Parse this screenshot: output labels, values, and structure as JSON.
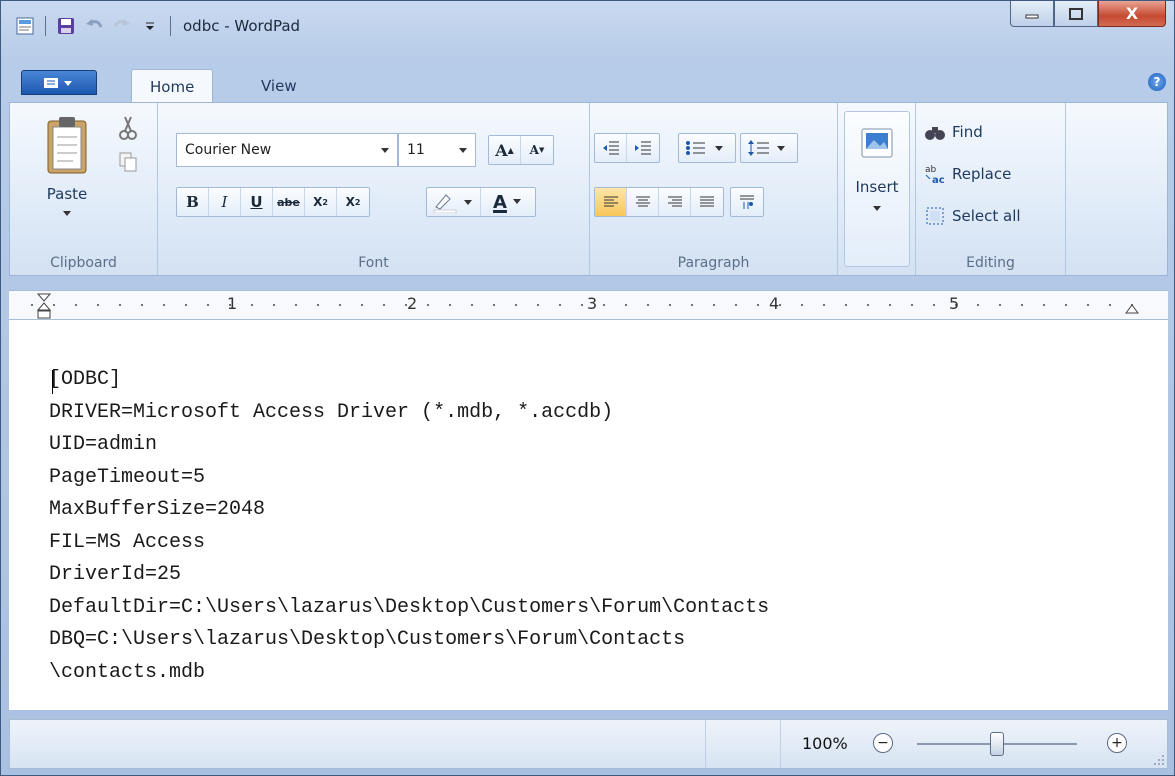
{
  "window": {
    "title": "odbc - WordPad",
    "buttons": {
      "minimize": "minimize",
      "maximize": "maximize",
      "close": "X"
    }
  },
  "tabs": [
    {
      "label": "Home"
    },
    {
      "label": "View"
    }
  ],
  "clipboard": {
    "paste_label": "Paste",
    "group_label": "Clipboard"
  },
  "font": {
    "family": "Courier New",
    "size": "11",
    "grow": "A",
    "shrink": "A",
    "bold": "B",
    "italic": "I",
    "underline": "U",
    "strike": "abe",
    "subscript": "X",
    "superscript": "X",
    "color_glyph": "A",
    "group_label": "Font"
  },
  "paragraph": {
    "group_label": "Paragraph"
  },
  "insert": {
    "label": "Insert"
  },
  "editing": {
    "find": "Find",
    "replace": "Replace",
    "select_all": "Select all",
    "group_label": "Editing"
  },
  "ruler": {
    "marks": [
      "1",
      "2",
      "3",
      "4",
      "5"
    ]
  },
  "document": {
    "lines": [
      "[ODBC]",
      "DRIVER=Microsoft Access Driver (*.mdb, *.accdb)",
      "UID=admin",
      "PageTimeout=5",
      "MaxBufferSize=2048",
      "FIL=MS Access",
      "DriverId=25",
      "DefaultDir=C:\\Users\\lazarus\\Desktop\\Customers\\Forum\\Contacts",
      "DBQ=C:\\Users\\lazarus\\Desktop\\Customers\\Forum\\Contacts",
      "\\contacts.mdb"
    ]
  },
  "status": {
    "zoom": "100%",
    "zoom_out": "−",
    "zoom_in": "+",
    "zoom_level": 0.5
  }
}
